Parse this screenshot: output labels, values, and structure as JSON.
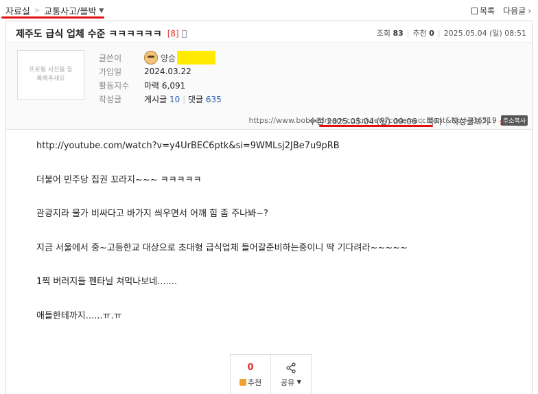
{
  "breadcrumb": {
    "home": "자료실",
    "separator": ">",
    "board": "교통사고/블박"
  },
  "topnav": {
    "list": "목록",
    "next": "다음글"
  },
  "post": {
    "title": "제주도 급식 업체 수준 ㅋㅋㅋㅋㅋㅋ",
    "comment_count": "[8]",
    "views_label": "조회",
    "views": "83",
    "recommend_label": "추천",
    "recommend": "0",
    "date": "2025.05.04 (일) 08:51"
  },
  "author": {
    "photo_placeholder": "프로필 사진을 등록해주세요",
    "name_label": "글쓴이",
    "name": "양승",
    "joined_label": "가입일",
    "joined": "2024.03.22",
    "activity_label": "활동지수",
    "activity": "마력 6,091",
    "posts_label": "작성글",
    "posts_text": "게시글",
    "posts": "10",
    "replies_text": "댓글",
    "replies": "635"
  },
  "actions": {
    "edited_label": "수정",
    "edited": "2025.05.04 (일) 09:06",
    "message": "쪽지",
    "view_posts": "작성글보기",
    "report": "신고"
  },
  "url": {
    "text": "https://www.bobaedream.co.kr/view?code=accident&No=836519",
    "copy": "주소복사"
  },
  "content": [
    "http://youtube.com/watch?v=y4UrBEC6ptk&si=9WMLsj2JBe7u9pRB",
    "더불어 민주당 집권 꼬라지~~~ ㅋㅋㅋㅋㅋ",
    "관광지라 물가 비싸다고 바가지 씌우면서 어깨 힘 좀 주나봐~?",
    "지금 서울에서 중~고등한교 대상으로 초대형 급식업체 들어갈준비하는중이니 딱 기다려라~~~~~",
    "1찍 버러지들 펜타닐 쳐먹나보네.......",
    "애들한테까지......ㅠ.ㅠ"
  ],
  "buttons": {
    "recommend_count": "0",
    "recommend": "추천",
    "share": "공유"
  },
  "colors": {
    "accent_red": "#e0322c",
    "link_blue": "#2a5db0",
    "highlight": "#ffeb00"
  }
}
